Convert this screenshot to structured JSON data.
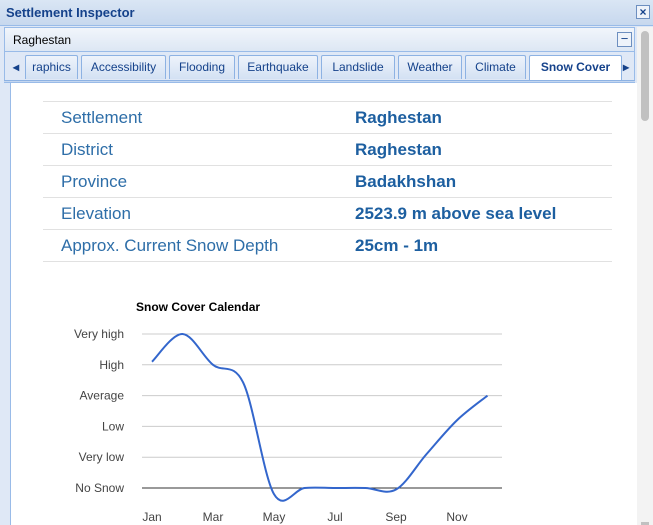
{
  "window": {
    "title": "Settlement Inspector"
  },
  "header": {
    "settlement_name": "Raghestan"
  },
  "tabs": [
    {
      "label": "raphics"
    },
    {
      "label": "Accessibility"
    },
    {
      "label": "Flooding"
    },
    {
      "label": "Earthquake"
    },
    {
      "label": "Landslide"
    },
    {
      "label": "Weather"
    },
    {
      "label": "Climate"
    },
    {
      "label": "Snow Cover",
      "active": true
    }
  ],
  "info": {
    "rows": [
      {
        "key": "Settlement",
        "value": "Raghestan"
      },
      {
        "key": "District",
        "value": "Raghestan"
      },
      {
        "key": "Province",
        "value": "Badakhshan"
      },
      {
        "key": "Elevation",
        "value": "2523.9 m above sea level"
      },
      {
        "key": "Approx. Current Snow Depth",
        "value": "25cm - 1m"
      }
    ]
  },
  "chart_data": {
    "type": "line",
    "title": "Snow Cover Calendar",
    "categories": [
      "Jan",
      "Feb",
      "Mar",
      "Apr",
      "May",
      "Jun",
      "Jul",
      "Aug",
      "Sep",
      "Oct",
      "Nov",
      "Dec"
    ],
    "x_tick_labels": [
      "Jan",
      "Mar",
      "May",
      "Jul",
      "Sep",
      "Nov"
    ],
    "y_tick_labels": [
      "No Snow",
      "Very low",
      "Low",
      "Average",
      "High",
      "Very high"
    ],
    "ylim": [
      0,
      5
    ],
    "series": [
      {
        "values": [
          4.1,
          5.0,
          4.0,
          3.4,
          -0.2,
          0.0,
          0.0,
          0.0,
          -0.05,
          1.1,
          2.2,
          3.0
        ]
      }
    ],
    "grid": true,
    "line_color": "#3366cc"
  }
}
